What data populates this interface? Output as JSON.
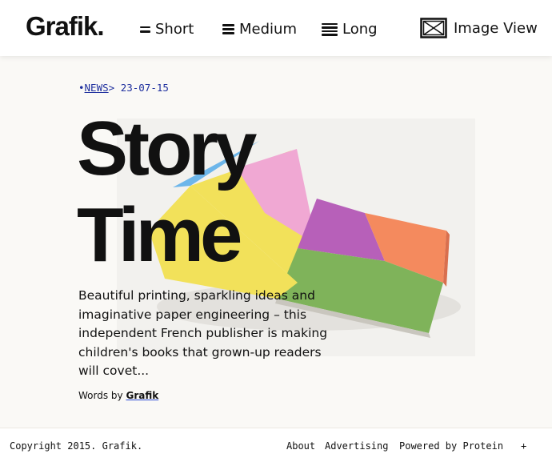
{
  "header": {
    "logo": "Grafik.",
    "nav": [
      {
        "label": "Short",
        "icon": "short-lines-icon"
      },
      {
        "label": "Medium",
        "icon": "medium-lines-icon"
      },
      {
        "label": "Long",
        "icon": "long-lines-icon"
      },
      {
        "label": "Image View",
        "icon": "image-icon"
      }
    ]
  },
  "article": {
    "category": "NEWS",
    "separator": ">",
    "date": "23-07-15",
    "title_line1": "Story",
    "title_line2": "Time",
    "deck": "Beautiful printing, sparkling ideas and imaginative paper engineering – this independent French publisher is making children's books that grown-up readers will covet...",
    "byline_prefix": "Words by",
    "byline_author": "Grafik"
  },
  "footer": {
    "copyright": "Copyright 2015. Grafik.",
    "links": [
      "About",
      "Advertising",
      "Powered by Protein"
    ],
    "plus": "+"
  },
  "colors": {
    "accent_link": "#1e2f9e",
    "background": "#faf9f6"
  }
}
